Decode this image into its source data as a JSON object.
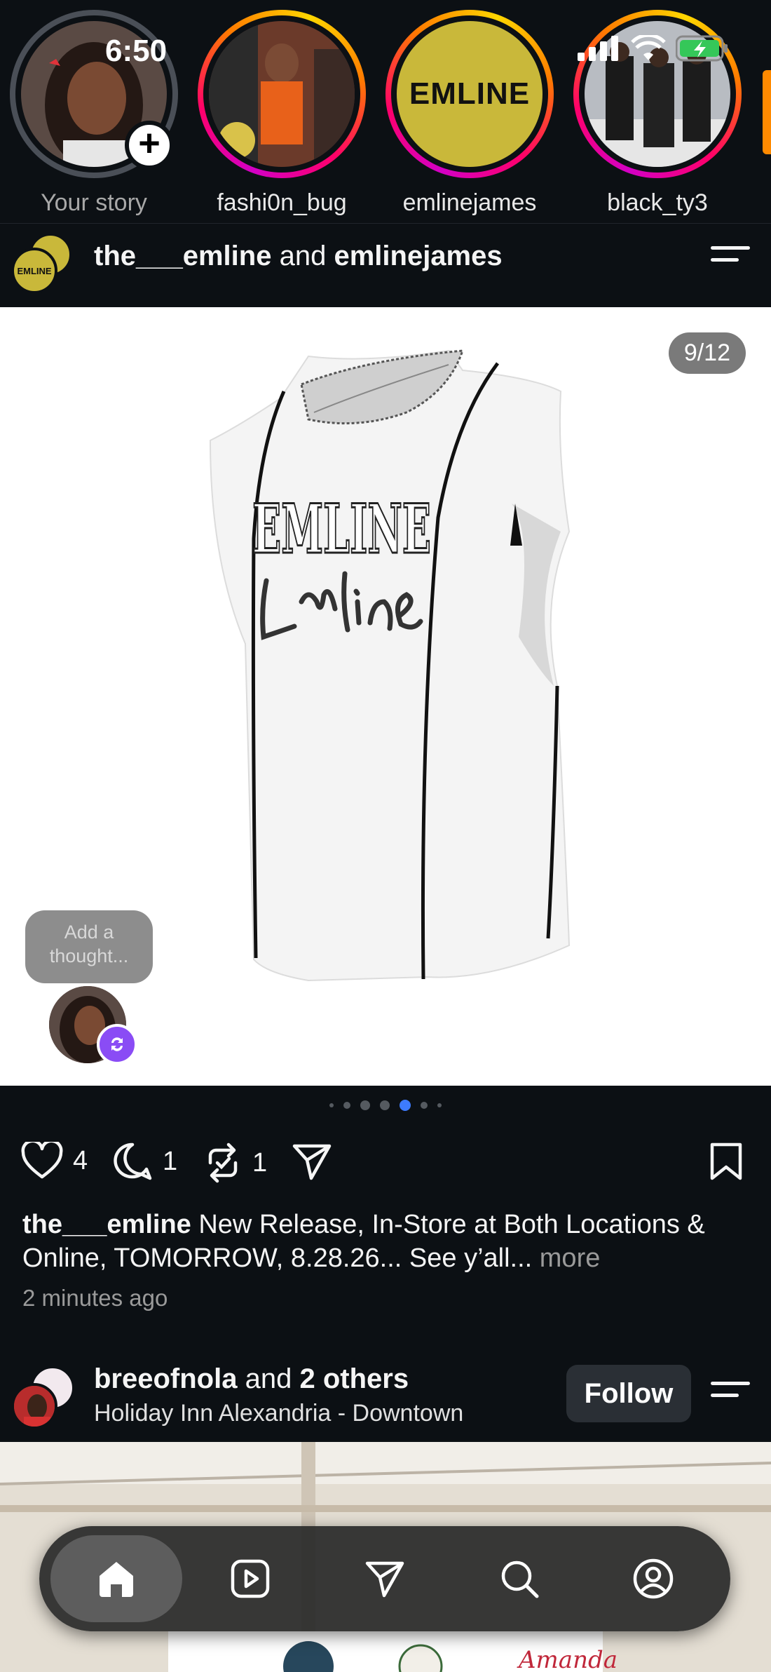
{
  "status_bar": {
    "time": "6:50"
  },
  "stories": [
    {
      "name": "Your story",
      "seen": true,
      "own": true
    },
    {
      "name": "fashi0n_bug",
      "seen": false
    },
    {
      "name": "emlinejames",
      "seen": false,
      "logo_text": "EMLINE"
    },
    {
      "name": "black_ty3",
      "seen": false
    }
  ],
  "post1": {
    "author_1": "the___emline",
    "connector": "and",
    "author_2": "emlinejames",
    "avatar_text": "EMLINE",
    "media_counter": "9/12",
    "thought_placeholder": "Add a thought...",
    "carousel": {
      "dots": 7,
      "active_index": 4
    },
    "likes": "4",
    "comments": "1",
    "reposts": "1",
    "caption_author": "the___emline",
    "caption_text": "New Release, In-Store at Both Locations & Online, TOMORROW, 8.28.26... See y’all...",
    "more_label": "more",
    "time_ago": "2 minutes ago"
  },
  "post2": {
    "author": "breeofnola",
    "connector": "and",
    "others": "2 others",
    "location": "Holiday Inn Alexandria - Downtown",
    "follow_label": "Follow"
  },
  "tabbar": {
    "items": [
      "home",
      "reels",
      "messages",
      "search",
      "profile"
    ],
    "active": "home"
  },
  "colors": {
    "background": "#0c1014",
    "active_dot": "#3d7bff",
    "repost_badge": "#8a4cf5",
    "emline_gold": "#c9b83a"
  }
}
